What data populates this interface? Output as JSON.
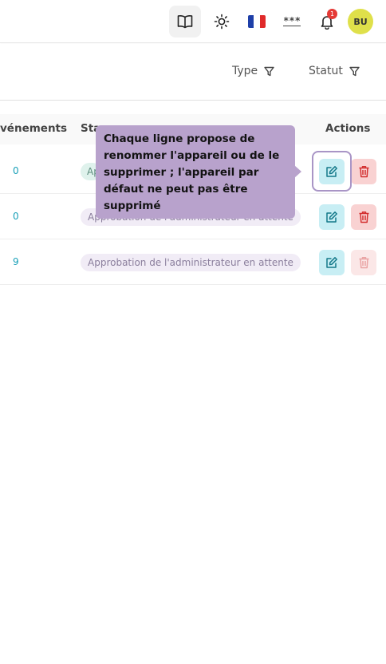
{
  "header": {
    "notification_count": "1",
    "avatar_initials": "BU",
    "password_label": "***",
    "icons": [
      "book-icon",
      "sun-icon",
      "flag-fr-icon",
      "password-icon",
      "bell-icon"
    ]
  },
  "filters": {
    "type_label": "Type",
    "status_label": "Statut"
  },
  "table": {
    "headers": {
      "events": "vénements",
      "status": "Sta",
      "actions": "Actions"
    },
    "rows": [
      {
        "events": "0",
        "status": "Ap"
      },
      {
        "events": "0",
        "status": "Approbation de l'administrateur en attente"
      },
      {
        "events": "9",
        "status": "Approbation de l'administrateur en attente"
      }
    ]
  },
  "tooltip": {
    "text": "Chaque ligne propose de renommer l'appareil ou de le supprimer ; l'appareil par défaut ne peut pas être supprimé"
  },
  "colors": {
    "accent_teal": "#1aa0b8",
    "edit_bg": "#c8eef4",
    "delete_bg": "#f9d2d2",
    "tooltip_bg": "#b8a2cc",
    "avatar_bg": "#dfe04a",
    "badge_red": "#e53935"
  }
}
